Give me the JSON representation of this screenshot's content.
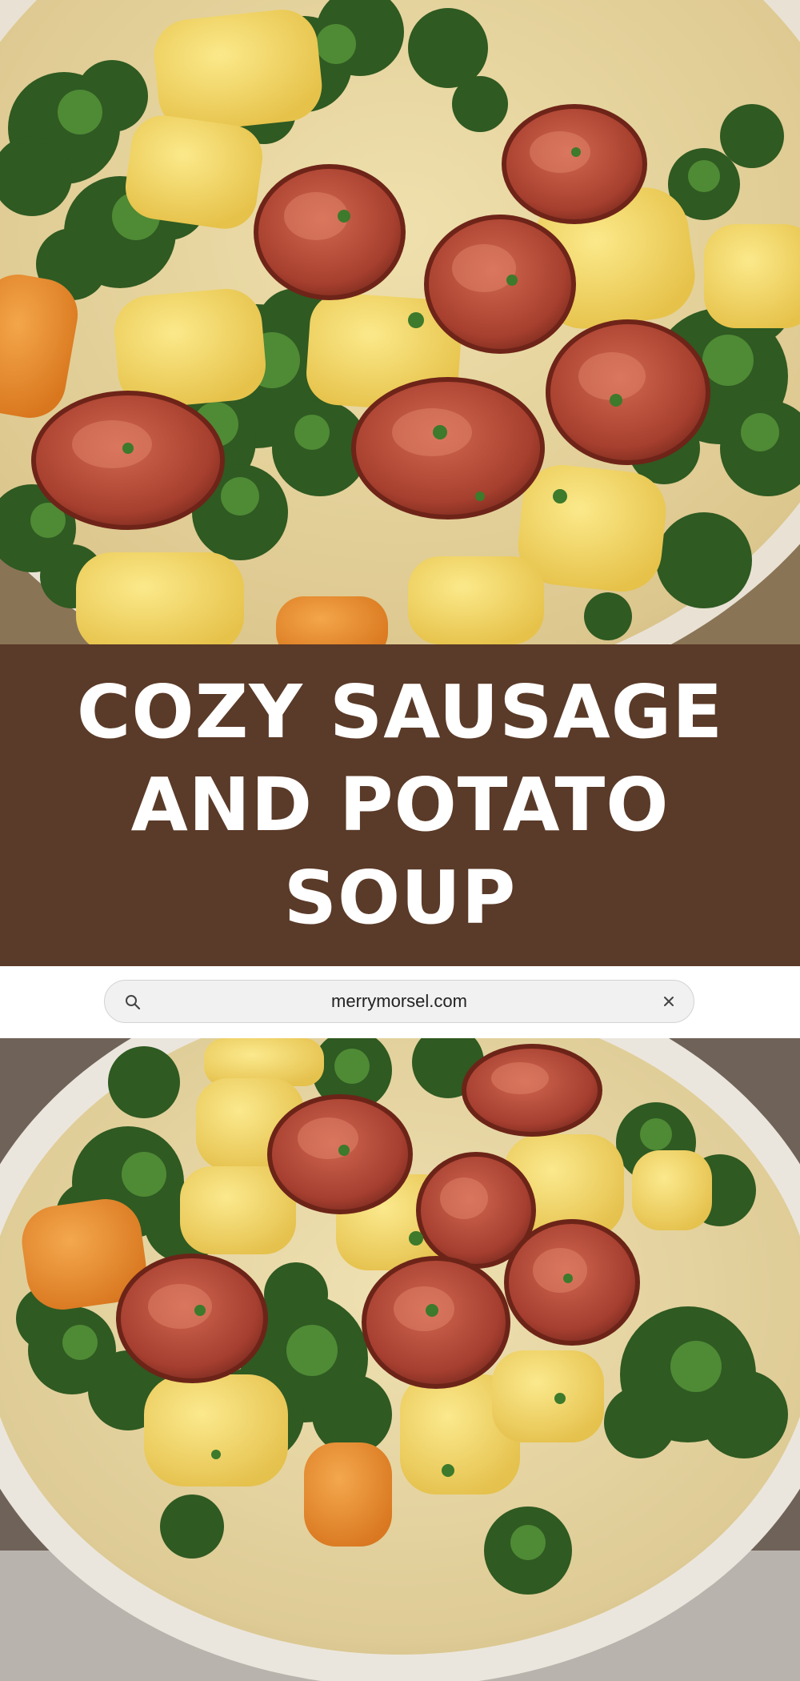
{
  "title": {
    "lines": [
      "COZY SAUSAGE",
      "AND POTATO",
      "SOUP"
    ]
  },
  "search_bar": {
    "url": "merrymorsel.com"
  },
  "images": {
    "top_photo": "soup-photo",
    "bottom_photo": "soup-photo"
  },
  "icons": {
    "search": "search-icon",
    "close": "close-icon"
  },
  "colors": {
    "title_band": "#5a3a28",
    "title_text": "#ffffff",
    "search_bar_bg": "#f1f1f1",
    "search_bar_border": "#d3d3d3",
    "url_text": "#222222"
  }
}
